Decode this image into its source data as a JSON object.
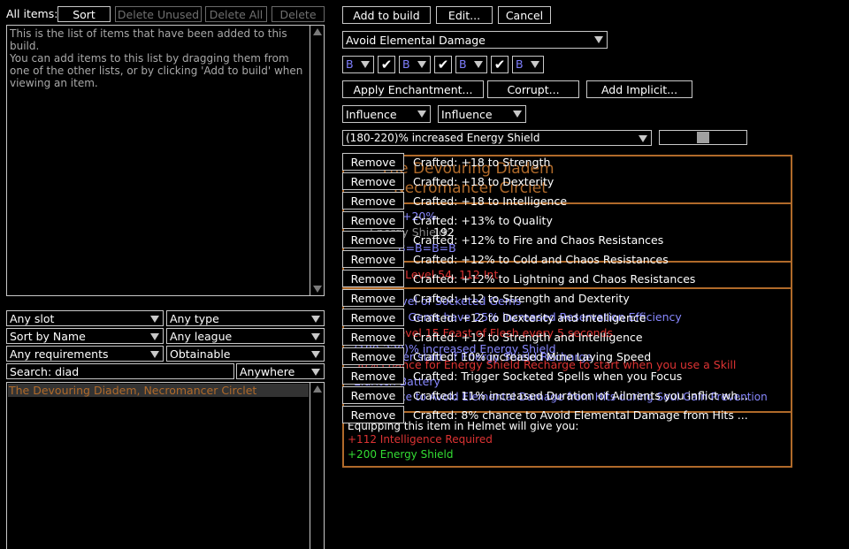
{
  "items_panel": {
    "label": "All items:",
    "sort_btn": "Sort",
    "delete_unused_btn": "Delete Unused",
    "delete_all_btn": "Delete All",
    "delete_btn": "Delete",
    "info_text": "This is the list of items that have been added to this build.\nYou can add items to this list by dragging them from\none of the other lists, or by clicking 'Add to build' when\nviewing an item."
  },
  "filters": {
    "slot": "Any slot",
    "type": "Any type",
    "sort": "Sort by Name",
    "league": "Any league",
    "requirements": "Any requirements",
    "obtainable": "Obtainable",
    "search_label": "Search:",
    "search_value": "diad",
    "search_scope": "Anywhere"
  },
  "db_list": {
    "items": [
      "The Devouring Diadem, Necromancer Circlet"
    ]
  },
  "editor": {
    "add_to_build": "Add to build",
    "edit": "Edit...",
    "cancel": "Cancel",
    "variant": "Avoid Elemental Damage",
    "sockets": [
      "B",
      "B",
      "B",
      "B"
    ],
    "apply_enchantment": "Apply Enchantment...",
    "corrupt": "Corrupt...",
    "add_implicit": "Add Implicit...",
    "influence1": "Influence",
    "influence2": "Influence",
    "range_mod": "(180-220)% increased Energy Shield"
  },
  "crafted": [
    {
      "remove": "Remove",
      "text": "Crafted: +18 to Strength"
    },
    {
      "remove": "Remove",
      "text": "Crafted: +18 to Dexterity"
    },
    {
      "remove": "Remove",
      "text": "Crafted: +18 to Intelligence"
    },
    {
      "remove": "Remove",
      "text": "Crafted: +13% to Quality"
    },
    {
      "remove": "Remove",
      "text": "Crafted: +12% to Fire and Chaos Resistances"
    },
    {
      "remove": "Remove",
      "text": "Crafted: +12% to Cold and Chaos Resistances"
    },
    {
      "remove": "Remove",
      "text": "Crafted: +12% to Lightning and Chaos Resistances"
    },
    {
      "remove": "Remove",
      "text": "Crafted: +12 to Strength and Dexterity"
    },
    {
      "remove": "Remove",
      "text": "Crafted: +12 to Dexterity and Intelligence"
    },
    {
      "remove": "Remove",
      "text": "Crafted: +12 to Strength and Intelligence"
    },
    {
      "remove": "Remove",
      "text": "Crafted: 10% increased Mine Laying Speed"
    },
    {
      "remove": "Remove",
      "text": "Crafted: Trigger Socketed Spells when you Focus"
    },
    {
      "remove": "Remove",
      "text": "Crafted: 11% increased Duration of Ailments you inflict wh..."
    },
    {
      "remove": "Remove",
      "text": "Crafted: 8% chance to Avoid Elemental Damage from Hits ..."
    }
  ],
  "tooltip": {
    "name": "The Devouring Diadem",
    "base": "Necromancer Circlet",
    "quality": "+20%",
    "es_label": "Energy Shield:",
    "es_value": "192",
    "sockets": "B=B=B=B",
    "req_level": "Requires Level 54, 112 Int",
    "implicit": "+1 to Level of Socketed Gems",
    "mod1": "Socketed Gems have 25% increased Reservation Efficiency",
    "mod2": "Trigger level 15 Feast of Flesh every 5 seconds",
    "mod3": "(180-220)% increased Energy Shield",
    "mod4": "50% faster start of Energy Shield Recharge",
    "mod5": "50% chance for Energy Shield Recharge to start when you use a Skill",
    "mod6": "Eldritch Battery",
    "mod7": "8% chance to Avoid Elemental Damage from Hits during Soul Gain Prevention",
    "equip_label": "Equipping this item in Helmet will give you:",
    "req_change": "+112 Intelligence Required",
    "es_change": "+200 Energy Shield"
  },
  "colors": {
    "unique": "#b06a2a",
    "magic": "#8888ff",
    "negative": "#dd3333",
    "positive": "#33dd33"
  }
}
